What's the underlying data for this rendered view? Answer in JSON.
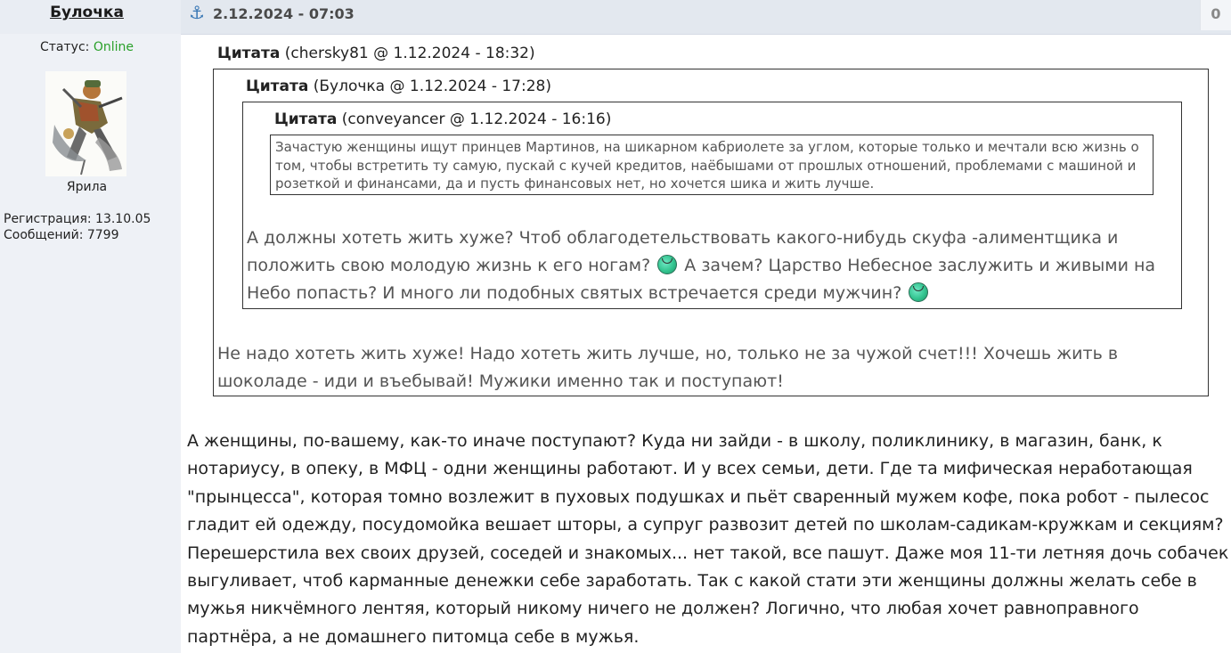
{
  "user": {
    "name": "Булочка",
    "status_label": "Статус:",
    "status_value": "Online",
    "title": "Ярила",
    "registration": "Регистрация: 13.10.05",
    "messages": "Сообщений: 7799"
  },
  "post": {
    "date": "2.12.2024 - 07:03",
    "count": "0",
    "quote1": {
      "label": "Цитата",
      "meta": "(chersky81 @ 1.12.2024 - 18:32)",
      "text": "Не надо хотеть жить хуже! Надо хотеть жить лучше, но, только не за чужой счет!!! Хочешь жить в шоколаде - иди и въебывай! Мужики именно так и поступают!"
    },
    "quote2": {
      "label": "Цитата",
      "meta": "(Булочка @ 1.12.2024 - 17:28)",
      "text_1": "А должны хотеть жить хуже? Чтоб облагодетельствовать какого-нибудь скуфа -алиментщика и положить свою молодую жизнь к его ногам?",
      "text_2": "А зачем? Царство Небесное заслужить и живыми на Небо попасть? И много ли подобных святых встречается среди мужчин?"
    },
    "quote3": {
      "label": "Цитата",
      "meta": "(conveyancer @ 1.12.2024 - 16:16)",
      "text": "Зачастую женщины ищут принцев Мартинов, на шикарном кабриолете за углом, которые только и мечтали всю жизнь о том, чтобы встретить ту самую, пускай с кучей кредитов, наёбышами от прошлых отношений, проблемами с машиной и розеткой и финансами, да и пусть финансовых нет, но хочется шика и жить лучше."
    },
    "body": "А женщины, по-вашему, как-то иначе поступают? Куда ни зайди - в школу, поликлинику, в магазин, банк, к нотариусу, в опеку, в МФЦ - одни женщины работают. И у всех семьи, дети. Где та мифическая неработающая \"прынцесса\", которая томно возлежит в пуховых подушках и пьёт сваренный мужем кофе, пока робот - пылесос гладит ей одежду, посудомойка вешает шторы, а супруг развозит детей по школам-садикам-кружкам и секциям? Перешерстила вех своих друзей, соседей и знакомых... нет такой, все пашут. Даже моя 11-ти летняя дочь собачек выгуливает, чтоб карманные денежки себе заработать. Так с какой стати эти женщины должны желать себе в мужья никчёмного лентяя, который никому ничего не должен? Логично, что любая хочет равноправного партнёра, а не домашнего питомца себе в мужья."
  },
  "icons": {
    "anchor": "anchor-icon",
    "smiley": "smiley-icon"
  },
  "colors": {
    "online": "#2aa02a",
    "anchor": "#3a78b5"
  }
}
